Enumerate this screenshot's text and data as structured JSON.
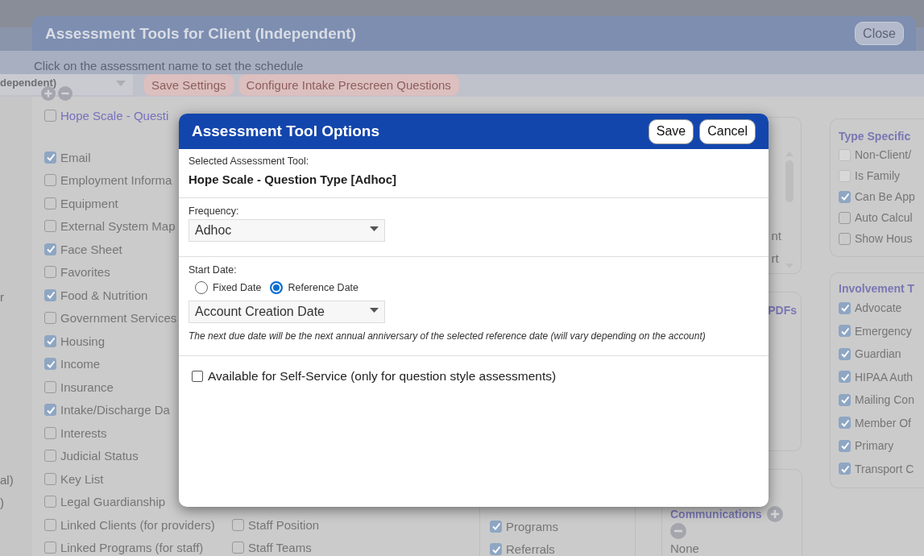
{
  "page_side_texts": [
    "r",
    "al)",
    ")"
  ],
  "background_window": {
    "title": "Assessment Tools for Client (Independent)",
    "close_button": "Close",
    "instruction": "Click on the assessment name to set the schedule",
    "toolbar": {
      "dropdown": "dependent)",
      "buttons": [
        "Save Settings",
        "Configure Intake Prescreen Questions"
      ]
    },
    "assessment_row": {
      "label": "Hope Scale - Questi",
      "checked": false
    },
    "topics": [
      {
        "label": "Email",
        "checked": true
      },
      {
        "label": "Employment Informa",
        "checked": false
      },
      {
        "label": "Equipment",
        "checked": false
      },
      {
        "label": "External System Map",
        "checked": false
      },
      {
        "label": "Face Sheet",
        "checked": true
      },
      {
        "label": "Favorites",
        "checked": false
      },
      {
        "label": "Food & Nutrition",
        "checked": true
      },
      {
        "label": "Government Services",
        "checked": false
      },
      {
        "label": "Housing",
        "checked": true
      },
      {
        "label": "Income",
        "checked": true
      },
      {
        "label": "Insurance",
        "checked": false
      },
      {
        "label": "Intake/Discharge Da",
        "checked": true
      },
      {
        "label": "Interests",
        "checked": false
      },
      {
        "label": "Judicial Status",
        "checked": false
      },
      {
        "label": "Key List",
        "checked": false
      },
      {
        "label": "Legal Guardianship",
        "checked": false
      },
      {
        "label": "Linked Clients (for providers)",
        "checked": false
      },
      {
        "label": "Linked Programs (for staff)",
        "checked": false
      }
    ],
    "topics_col2": [
      {
        "label": "Staff Position",
        "checked": false
      },
      {
        "label": "Staff Teams",
        "checked": false
      }
    ],
    "list_panel": {
      "texts": [
        "nt",
        "rt"
      ]
    },
    "pdf_panel": {
      "title": "PDFs"
    },
    "programs_panel": {
      "items": [
        {
          "label": "Programs",
          "checked": true
        },
        {
          "label": "Referrals",
          "checked": true
        }
      ]
    },
    "communications_panel": {
      "title": "Communications",
      "value": "None"
    },
    "type_specific": {
      "title": "Type Specific",
      "items": [
        {
          "label": "Non-Client/",
          "checked": false,
          "disabled": true
        },
        {
          "label": "Is Family",
          "checked": false,
          "disabled": true
        },
        {
          "label": "Can Be App",
          "checked": true,
          "disabled": false
        },
        {
          "label": "Auto Calcul",
          "checked": false,
          "disabled": false
        },
        {
          "label": "Show Hous",
          "checked": false,
          "disabled": false
        }
      ]
    },
    "involvement": {
      "title": "Involvement T",
      "items": [
        {
          "label": "Advocate",
          "checked": true
        },
        {
          "label": "Emergency",
          "checked": true
        },
        {
          "label": "Guardian",
          "checked": true
        },
        {
          "label": "HIPAA Auth",
          "checked": true
        },
        {
          "label": "Mailing Con",
          "checked": true
        },
        {
          "label": "Member Of",
          "checked": true
        },
        {
          "label": "Primary",
          "checked": true
        },
        {
          "label": "Transport C",
          "checked": true
        }
      ]
    }
  },
  "modal": {
    "title": "Assessment Tool Options",
    "buttons": [
      "Save",
      "Cancel"
    ],
    "selected_label": "Selected Assessment Tool:",
    "selected_value": "Hope Scale - Question Type [Adhoc]",
    "frequency": {
      "label": "Frequency:",
      "value": "Adhoc"
    },
    "start_date": {
      "label": "Start Date:",
      "options": [
        {
          "label": "Fixed Date",
          "selected": false
        },
        {
          "label": "Reference Date",
          "selected": true
        }
      ],
      "reference": "Account Creation Date",
      "note": "The next due date will be the next annual anniversary of the selected reference date (will vary depending on the account)"
    },
    "self_service": {
      "label": "Available for Self-Service (only for question style assessments)",
      "checked": false
    }
  }
}
